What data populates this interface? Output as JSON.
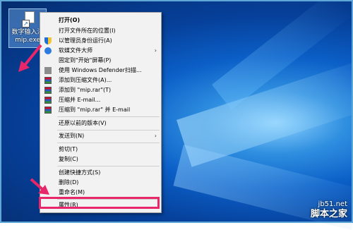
{
  "desktop": {
    "icon": {
      "label_line1": "数字输入法",
      "label_line2": "mip.exe"
    }
  },
  "context_menu": {
    "items": [
      {
        "label": "打开(O)",
        "icon": ""
      },
      {
        "label": "打开文件所在的位置(I)",
        "icon": ""
      },
      {
        "label": "以管理员身份运行(A)",
        "icon": "uac-shield-icon"
      },
      {
        "label": "软媒文件大师",
        "icon": "ruanmei-icon",
        "submenu": true
      },
      {
        "label": "固定到\"开始\"屏幕(P)",
        "icon": ""
      },
      {
        "label": "使用 Windows Defender扫描...",
        "icon": "windows-defender-icon"
      },
      {
        "label": "添加到压缩文件(A)...",
        "icon": "winrar-icon"
      },
      {
        "label": "添加到 \"mip.rar\"(T)",
        "icon": "winrar-icon"
      },
      {
        "label": "压缩并 E-mail...",
        "icon": "winrar-icon"
      },
      {
        "label": "压缩到 \"mip.rar\" 并 E-mail",
        "icon": "winrar-icon"
      },
      {
        "label": "还原以前的版本(V)",
        "icon": ""
      },
      {
        "label": "发送到(N)",
        "icon": "",
        "submenu": true
      },
      {
        "label": "剪切(T)",
        "icon": ""
      },
      {
        "label": "复制(C)",
        "icon": ""
      },
      {
        "label": "创建快捷方式(S)",
        "icon": ""
      },
      {
        "label": "删除(D)",
        "icon": ""
      },
      {
        "label": "重命名(M)",
        "icon": ""
      },
      {
        "label": "属性(R)",
        "icon": ""
      }
    ],
    "submenu_arrow": "›",
    "highlight_color": "#e8276a"
  },
  "watermark": {
    "url": "jb51.net",
    "site": "脚本之家"
  }
}
